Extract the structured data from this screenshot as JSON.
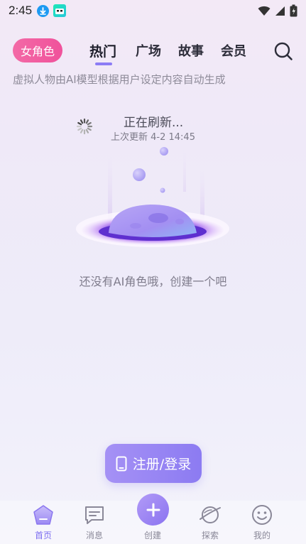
{
  "status_bar": {
    "time": "2:45"
  },
  "top_nav": {
    "role_filter": "女角色",
    "tabs": [
      {
        "label": "热门",
        "active": true
      },
      {
        "label": "广场",
        "active": false
      },
      {
        "label": "故事",
        "active": false
      },
      {
        "label": "会员",
        "active": false
      }
    ]
  },
  "disclaimer": "虚拟人物由AI模型根据用户设定内容自动生成",
  "refresh": {
    "title": "正在刷新...",
    "last_updated": "上次更新 4-2 14:45"
  },
  "empty_state": {
    "message": "还没有AI角色哦，创建一个吧"
  },
  "login_button": {
    "label": "注册/登录"
  },
  "bottom_nav": {
    "items": [
      {
        "label": "首页",
        "icon": "home-icon",
        "active": true
      },
      {
        "label": "消息",
        "icon": "message-icon",
        "active": false
      },
      {
        "label": "创建",
        "icon": "plus-icon",
        "active": false
      },
      {
        "label": "探索",
        "icon": "planet-icon",
        "active": false
      },
      {
        "label": "我的",
        "icon": "smile-icon",
        "active": false
      }
    ]
  },
  "colors": {
    "accent": "#8c7cf5",
    "pill": "#f0529b"
  }
}
